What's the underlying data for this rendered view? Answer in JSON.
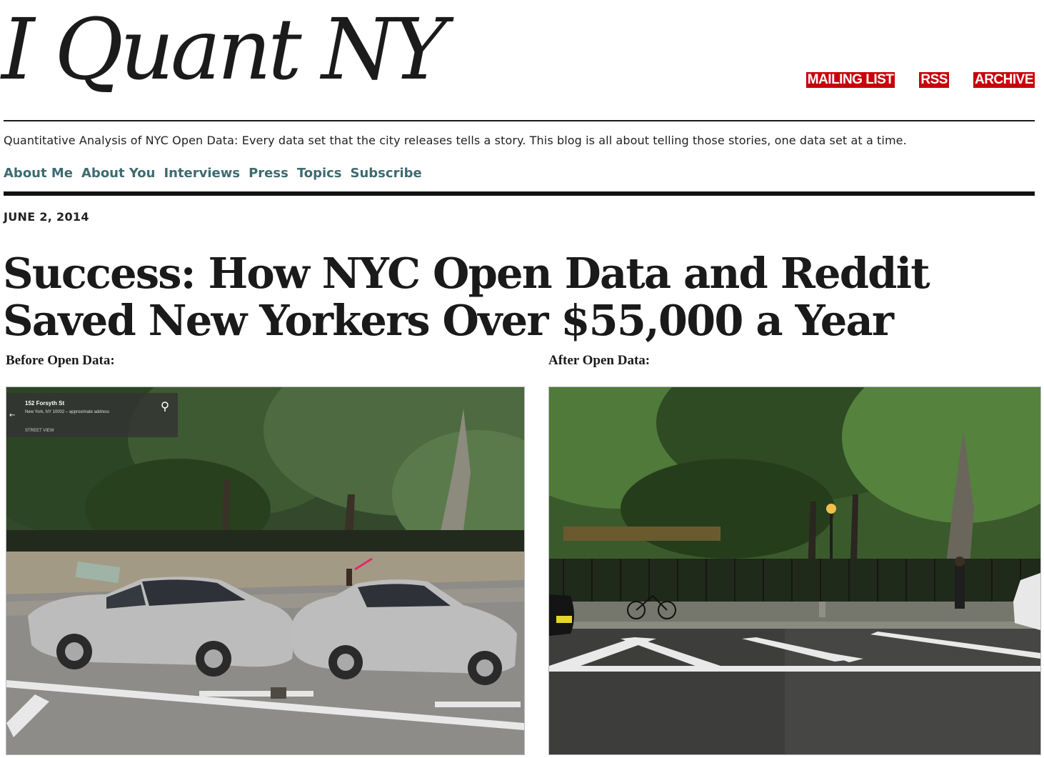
{
  "header": {
    "logo_text": "I Quant NY",
    "links": [
      "MAILING LIST",
      "RSS",
      "ARCHIVE"
    ],
    "tagline": "Quantitative Analysis of NYC Open Data: Every data set that the city releases tells a story. This blog is all about telling those stories, one data set at a time."
  },
  "nav": {
    "items": [
      "About Me",
      "About You",
      "Interviews",
      "Press",
      "Topics",
      "Subscribe"
    ]
  },
  "post": {
    "date": "JUNE 2, 2014",
    "title_line1": "Success: How NYC Open Data and Reddit",
    "title_line2": "Saved New Yorkers Over $55,000 a Year",
    "before_caption": "Before Open Data:",
    "after_caption": "After Open Data:",
    "streetview": {
      "address": "152 Forsyth St",
      "subaddress": "New York, NY 10002 – approximate address",
      "label": "STREET VIEW"
    }
  },
  "colors": {
    "link_red": "#c8000a",
    "nav_teal": "#3d6b70",
    "rule": "#111111"
  }
}
